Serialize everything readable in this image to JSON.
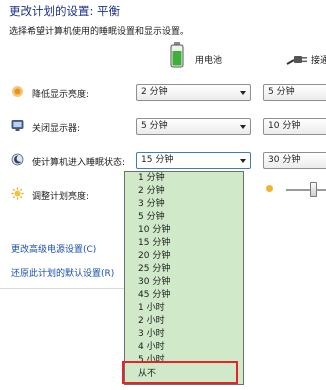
{
  "header": {
    "title": "更改计划的设置: 平衡",
    "subtitle": "选择希望计算机使用的睡眠设置和显示设置。"
  },
  "columns": {
    "battery": "用电池",
    "plugged": "接通"
  },
  "rows": [
    {
      "label": "降低显示亮度:",
      "battery": "2 分钟",
      "plugged": "5 分钟"
    },
    {
      "label": "关闭显示器:",
      "battery": "5 分钟",
      "plugged": "10 分钟"
    },
    {
      "label": "使计算机进入睡眠状态:",
      "battery": "15 分钟",
      "plugged": "30 分钟"
    },
    {
      "label": "调整计划亮度:"
    }
  ],
  "links": {
    "advanced": "更改高级电源设置(C)",
    "restore": "还原此计划的默认设置(R)"
  },
  "dropdown_options": [
    "1 分钟",
    "2 分钟",
    "3 分钟",
    "5 分钟",
    "10 分钟",
    "15 分钟",
    "20 分钟",
    "25 分钟",
    "30 分钟",
    "45 分钟",
    "1 小时",
    "2 小时",
    "3 小时",
    "4 小时",
    "5 小时",
    "从不"
  ],
  "colors": {
    "title": "#1e3287",
    "link": "#1a4fb3",
    "dropdown_bg": "#cfe9c9",
    "highlight_border": "#e0262b"
  }
}
